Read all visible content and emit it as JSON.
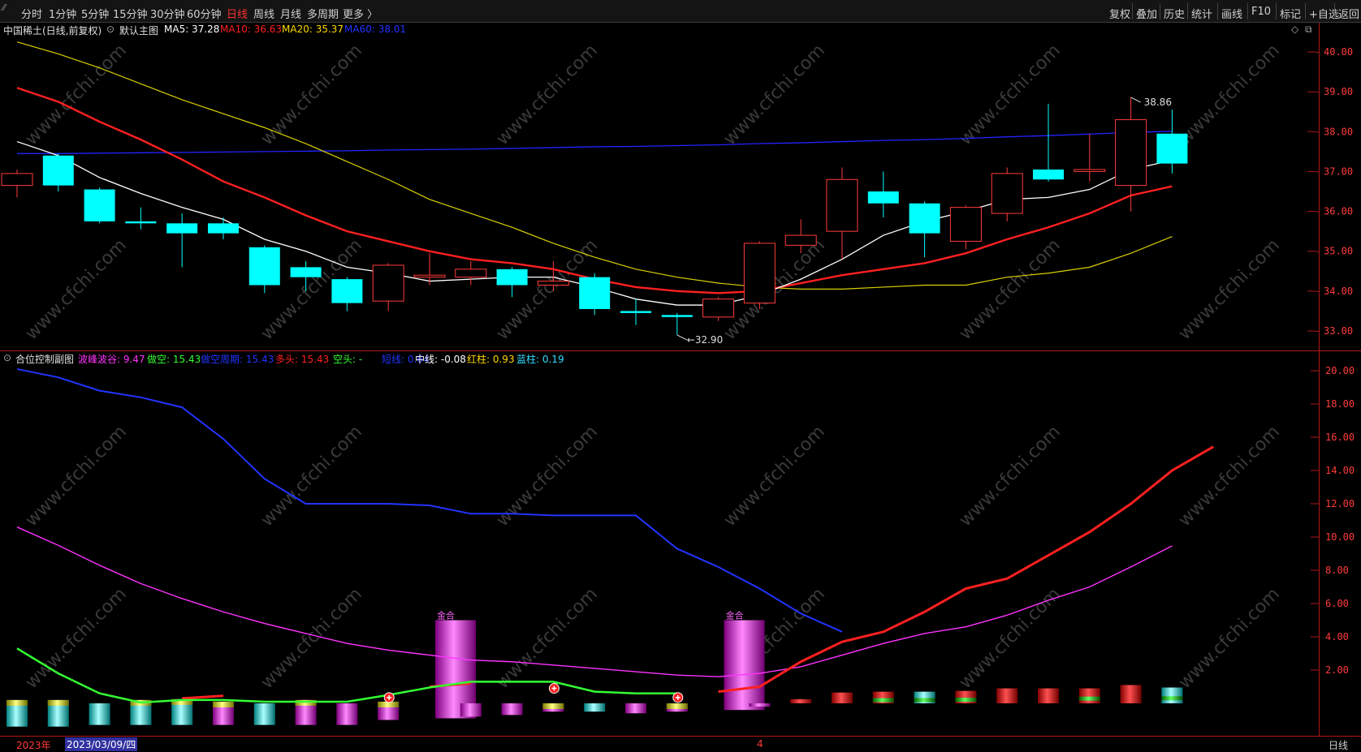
{
  "toolbar": {
    "left_items": [
      "分时",
      "1分钟",
      "5分钟",
      "15分钟",
      "30分钟",
      "60分钟",
      "日线",
      "周线",
      "月线",
      "多周期",
      "更多 〉"
    ],
    "active_item": "日线",
    "right_items": [
      "复权",
      "叠加",
      "历史",
      "统计",
      "画线",
      "F10",
      "标记",
      "+自选",
      "返回"
    ]
  },
  "main_header": {
    "title": "中国稀土(日线,前复权)",
    "template": "默认主图",
    "ma": [
      {
        "label": "MA5: 37.28",
        "color": "#ffffff"
      },
      {
        "label": "MA10: 36.63",
        "color": "#ff2020"
      },
      {
        "label": "MA20: 35.37",
        "color": "#ffd800"
      },
      {
        "label": "MA60: 38.01",
        "color": "#2233ff"
      }
    ]
  },
  "sub_header": {
    "title": "合位控制副图",
    "items": [
      {
        "label": "波峰波谷: 9.47",
        "color": "#ff33ff"
      },
      {
        "label": "做空: 15.43",
        "color": "#33ff33"
      },
      {
        "label": "做空周期: 15.43",
        "color": "#2233ff"
      },
      {
        "label": "多头: 15.43",
        "color": "#ff2020"
      },
      {
        "label": "空头: -",
        "color": "#33ff33"
      },
      {
        "label": "短线: 0.64",
        "color": "#2233ff"
      },
      {
        "label": "中线: -0.08",
        "color": "#ffffff"
      },
      {
        "label": "红柱: 0.93",
        "color": "#ffd800"
      },
      {
        "label": "蓝柱: 0.19",
        "color": "#33ddff"
      }
    ]
  },
  "price_axis": {
    "ticks": [
      "40.00",
      "39.00",
      "38.00",
      "37.00",
      "36.00",
      "35.00",
      "34.00",
      "33.00"
    ]
  },
  "sub_axis": {
    "ticks": [
      "20.00",
      "18.00",
      "16.00",
      "14.00",
      "12.00",
      "10.00",
      "8.00",
      "6.00",
      "4.00",
      "2.00"
    ]
  },
  "annotations": {
    "high": "38.86",
    "low": "32.90",
    "signal": "金合"
  },
  "bottom_bar": {
    "year": "2023年",
    "date": "2023/03/09/四",
    "month_mark": "4",
    "period": "日线"
  },
  "watermark": "www.cfchi.com",
  "colors": {
    "up": "#ff3b3b",
    "down": "#00ffff",
    "axis": "#b01818",
    "ma5": "#ffffff",
    "ma10": "#ff2020",
    "ma20": "#d8d000",
    "ma60": "#2222ff"
  },
  "chart_data": [
    {
      "type": "candlestick",
      "title": "中国稀土(日线,前复权)",
      "ylim": [
        32.6,
        40.4
      ],
      "candles": [
        {
          "o": 36.65,
          "c": 36.95,
          "h": 37.05,
          "l": 36.35
        },
        {
          "o": 37.4,
          "c": 36.65,
          "h": 37.45,
          "l": 36.5
        },
        {
          "o": 36.55,
          "c": 35.75,
          "h": 36.6,
          "l": 35.7
        },
        {
          "o": 35.75,
          "c": 35.7,
          "h": 36.1,
          "l": 35.55
        },
        {
          "o": 35.7,
          "c": 35.45,
          "h": 35.95,
          "l": 34.6
        },
        {
          "o": 35.7,
          "c": 35.45,
          "h": 35.85,
          "l": 35.3
        },
        {
          "o": 35.1,
          "c": 34.15,
          "h": 35.15,
          "l": 33.95
        },
        {
          "o": 34.6,
          "c": 34.35,
          "h": 34.75,
          "l": 34.0
        },
        {
          "o": 34.3,
          "c": 33.7,
          "h": 34.35,
          "l": 33.5
        },
        {
          "o": 33.75,
          "c": 34.65,
          "h": 34.7,
          "l": 33.5
        },
        {
          "o": 34.35,
          "c": 34.4,
          "h": 34.95,
          "l": 34.15
        },
        {
          "o": 34.35,
          "c": 34.55,
          "h": 34.75,
          "l": 34.15
        },
        {
          "o": 34.55,
          "c": 34.15,
          "h": 34.6,
          "l": 33.85
        },
        {
          "o": 34.15,
          "c": 34.25,
          "h": 34.75,
          "l": 34.0
        },
        {
          "o": 34.35,
          "c": 33.55,
          "h": 34.45,
          "l": 33.4
        },
        {
          "o": 33.5,
          "c": 33.45,
          "h": 33.8,
          "l": 33.15
        },
        {
          "o": 33.4,
          "c": 33.35,
          "h": 33.45,
          "l": 32.9
        },
        {
          "o": 33.35,
          "c": 33.8,
          "h": 33.85,
          "l": 33.25
        },
        {
          "o": 33.7,
          "c": 35.2,
          "h": 35.25,
          "l": 33.55
        },
        {
          "o": 35.15,
          "c": 35.4,
          "h": 35.8,
          "l": 34.95
        },
        {
          "o": 35.5,
          "c": 36.8,
          "h": 37.1,
          "l": 34.8
        },
        {
          "o": 36.5,
          "c": 36.2,
          "h": 37.0,
          "l": 35.85
        },
        {
          "o": 36.2,
          "c": 35.45,
          "h": 36.25,
          "l": 34.85
        },
        {
          "o": 35.25,
          "c": 36.1,
          "h": 36.15,
          "l": 35.05
        },
        {
          "o": 35.95,
          "c": 36.95,
          "h": 37.1,
          "l": 35.75
        },
        {
          "o": 37.05,
          "c": 36.8,
          "h": 38.7,
          "l": 36.75
        },
        {
          "o": 37.0,
          "c": 37.05,
          "h": 37.95,
          "l": 36.75
        },
        {
          "o": 36.65,
          "c": 38.3,
          "h": 38.86,
          "l": 36.0
        },
        {
          "o": 37.95,
          "c": 37.2,
          "h": 38.55,
          "l": 36.95
        }
      ],
      "ma5": [
        37.75,
        37.4,
        36.85,
        36.45,
        36.1,
        35.8,
        35.3,
        35.0,
        34.6,
        34.45,
        34.25,
        34.3,
        34.35,
        34.35,
        34.1,
        33.8,
        33.65,
        33.65,
        33.9,
        34.3,
        34.8,
        35.4,
        35.75,
        36.0,
        36.3,
        36.35,
        36.55,
        37.05,
        37.28
      ],
      "ma10": [
        39.1,
        38.75,
        38.25,
        37.8,
        37.3,
        36.75,
        36.35,
        35.9,
        35.5,
        35.25,
        35.0,
        34.8,
        34.7,
        34.55,
        34.3,
        34.1,
        34.0,
        33.95,
        34.0,
        34.2,
        34.4,
        34.55,
        34.7,
        34.95,
        35.3,
        35.6,
        35.95,
        36.4,
        36.63
      ],
      "ma20": [
        40.25,
        39.95,
        39.6,
        39.2,
        38.8,
        38.45,
        38.1,
        37.7,
        37.25,
        36.8,
        36.3,
        35.95,
        35.6,
        35.2,
        34.85,
        34.55,
        34.35,
        34.2,
        34.1,
        34.05,
        34.05,
        34.1,
        34.15,
        34.15,
        34.35,
        34.45,
        34.6,
        34.95,
        35.37
      ],
      "ma60": [
        37.45,
        37.45,
        37.46,
        37.47,
        37.48,
        37.49,
        37.5,
        37.51,
        37.52,
        37.54,
        37.55,
        37.56,
        37.58,
        37.6,
        37.62,
        37.63,
        37.65,
        37.67,
        37.7,
        37.72,
        37.75,
        37.78,
        37.8,
        37.83,
        37.87,
        37.9,
        37.94,
        37.98,
        38.01
      ]
    },
    {
      "type": "line",
      "title": "合位控制副图",
      "ylim": [
        0,
        21
      ],
      "series": [
        {
          "name": "做空周期",
          "color": "#2233ff",
          "values": [
            20.1,
            19.6,
            18.8,
            18.4,
            17.8,
            15.9,
            13.5,
            12.0,
            12.0,
            12.0,
            11.9,
            11.4,
            11.4,
            11.3,
            11.3,
            11.3,
            9.3,
            8.2,
            6.9,
            5.4,
            4.3
          ]
        },
        {
          "name": "波峰波谷",
          "color": "#ff33ff",
          "values": [
            10.6,
            9.5,
            8.3,
            7.2,
            6.3,
            5.5,
            4.8,
            4.2,
            3.6,
            3.2,
            2.9,
            2.6,
            2.5,
            2.3,
            2.1,
            1.9,
            1.7,
            1.6,
            1.8,
            2.2,
            2.9,
            3.6,
            4.2,
            4.6,
            5.3,
            6.2,
            7.0,
            8.2,
            9.47
          ]
        },
        {
          "name": "多头",
          "color": "#ff2020",
          "values": [
            null,
            null,
            null,
            null,
            0.3,
            0.45,
            null,
            null,
            null,
            null,
            1.0,
            1.2,
            null,
            null,
            null,
            null,
            null,
            0.7,
            1.0,
            2.5,
            3.7,
            4.3,
            5.5,
            6.9,
            7.5,
            8.9,
            10.3,
            12.0,
            14.0,
            15.43
          ]
        },
        {
          "name": "做空",
          "color": "#33ff33",
          "values": [
            3.3,
            1.8,
            0.6,
            0.05,
            0.2,
            0.2,
            0.1,
            0.1,
            0.1,
            0.5,
            0.95,
            1.3,
            1.3,
            1.3,
            0.7,
            0.6,
            0.6
          ]
        }
      ],
      "bars": [
        {
          "top": 0.2,
          "bottom": -1.4,
          "kind": "cyanyellow"
        },
        {
          "top": 0.2,
          "bottom": -1.4,
          "kind": "cyanyellow"
        },
        {
          "top": 0.0,
          "bottom": -1.3,
          "kind": "cyan"
        },
        {
          "top": 0.2,
          "bottom": -1.3,
          "kind": "cyanyellow"
        },
        {
          "top": 0.25,
          "bottom": -1.3,
          "kind": "cyanyellow"
        },
        {
          "top": 0.1,
          "bottom": -1.3,
          "kind": "magentayellow"
        },
        {
          "top": 0.0,
          "bottom": -1.3,
          "kind": "cyan"
        },
        {
          "top": 0.2,
          "bottom": -1.3,
          "kind": "magentayellow"
        },
        {
          "top": 0.0,
          "bottom": -1.3,
          "kind": "magenta"
        },
        {
          "top": 0.1,
          "bottom": -1.0,
          "kind": "magentayellow"
        },
        {
          "top": 5.0,
          "bottom": -0.9,
          "kind": "magentabig"
        },
        {
          "top": 0.0,
          "bottom": -0.8,
          "kind": "magenta"
        },
        {
          "top": 0.0,
          "bottom": -0.7,
          "kind": "magenta"
        },
        {
          "top": 0.0,
          "bottom": -0.5,
          "kind": "magentayellow"
        },
        {
          "top": 0.0,
          "bottom": -0.5,
          "kind": "cyan"
        },
        {
          "top": 0.0,
          "bottom": -0.6,
          "kind": "magenta"
        },
        {
          "top": 0.0,
          "bottom": -0.5,
          "kind": "magentayellow"
        },
        {
          "top": 5.0,
          "bottom": -0.4,
          "kind": "magentabig"
        },
        {
          "top": 0.0,
          "bottom": -0.2,
          "kind": "magenta"
        },
        {
          "top": 0.25,
          "bottom": 0.0,
          "kind": "red"
        },
        {
          "top": 0.65,
          "bottom": 0.0,
          "kind": "red"
        },
        {
          "top": 0.7,
          "bottom": 0.0,
          "kind": "redgreen"
        },
        {
          "top": 0.7,
          "bottom": 0.0,
          "kind": "cyangreen"
        },
        {
          "top": 0.75,
          "bottom": 0.0,
          "kind": "redgreen"
        },
        {
          "top": 0.9,
          "bottom": 0.0,
          "kind": "red"
        },
        {
          "top": 0.9,
          "bottom": 0.0,
          "kind": "red"
        },
        {
          "top": 0.9,
          "bottom": 0.0,
          "kind": "redgreen"
        },
        {
          "top": 1.1,
          "bottom": 0.0,
          "kind": "red"
        },
        {
          "top": 0.95,
          "bottom": 0.0,
          "kind": "cyangreen"
        }
      ],
      "plus_markers": [
        9,
        13,
        16
      ]
    }
  ]
}
